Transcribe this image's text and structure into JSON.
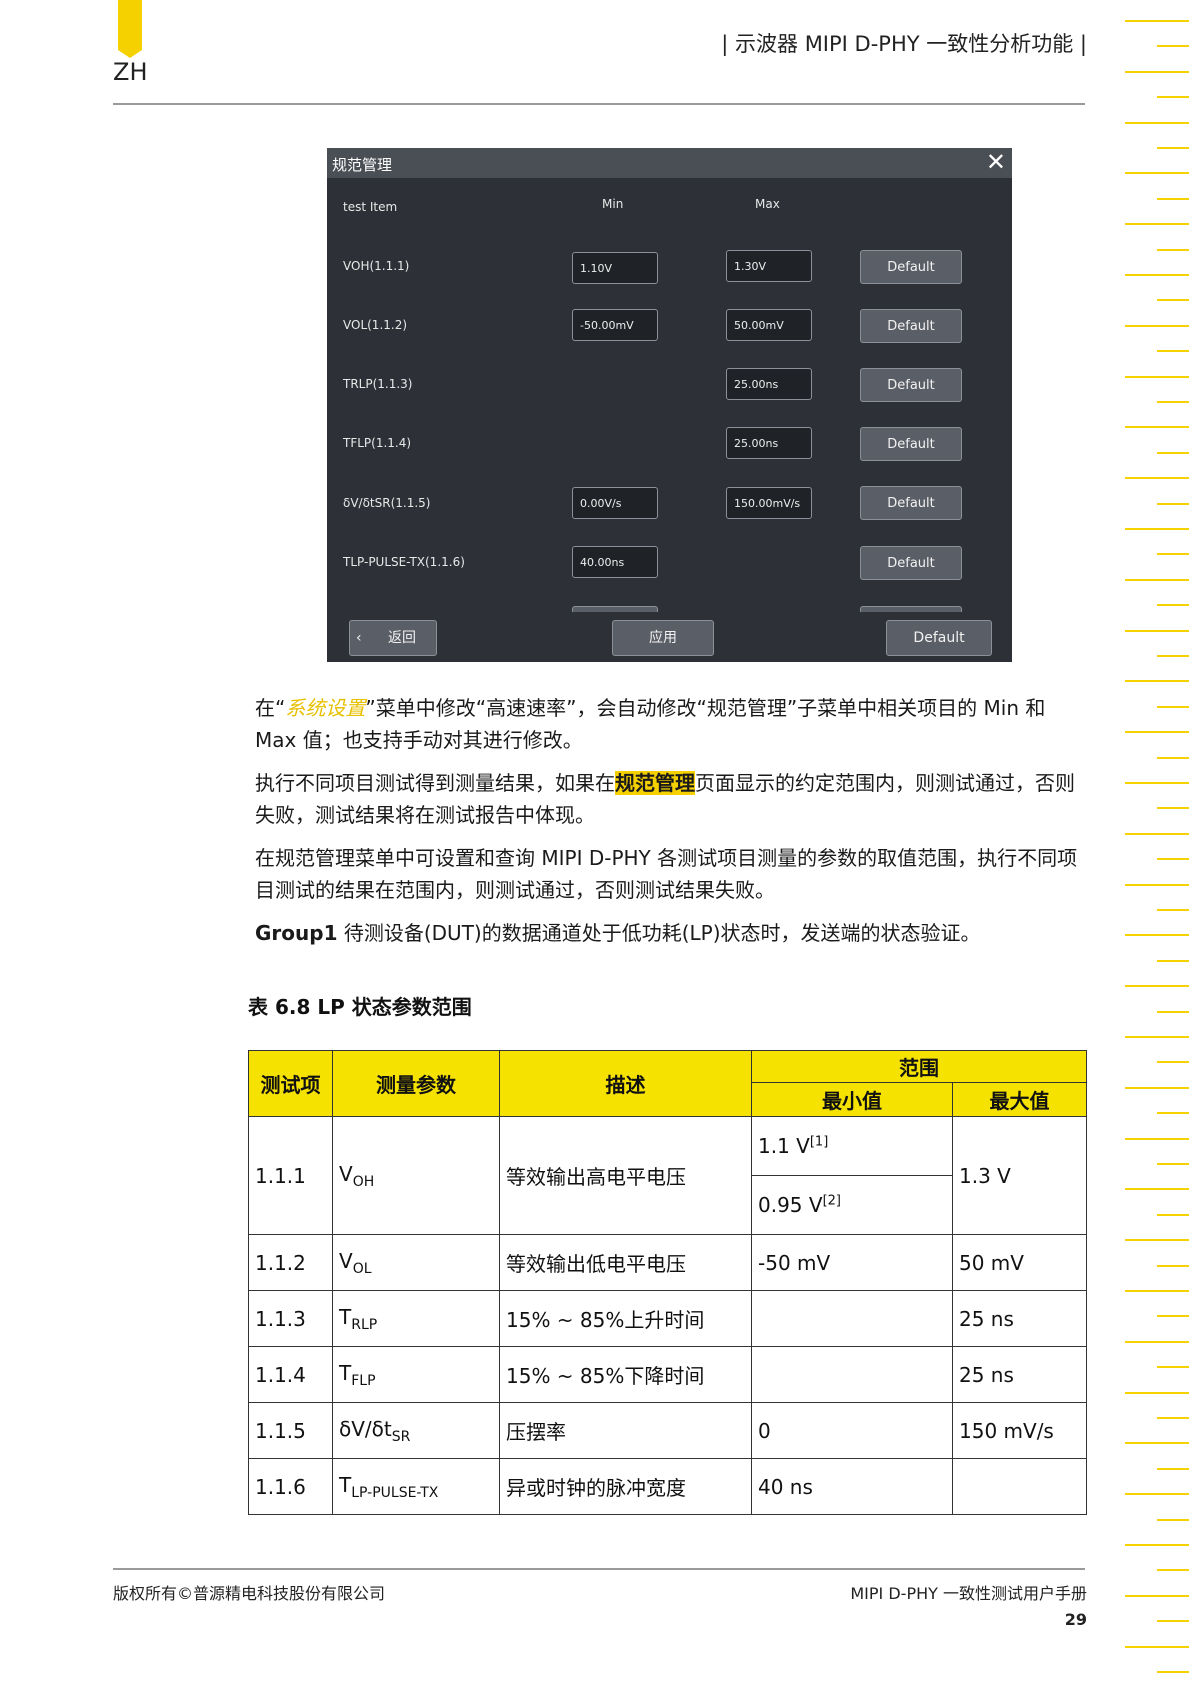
{
  "header": {
    "lang": "ZH",
    "title": "| 示波器 MIPI D-PHY 一致性分析功能 |"
  },
  "dialog": {
    "title": "规范管理",
    "col_test_item": "test Item",
    "col_min": "Min",
    "col_max": "Max",
    "rows": [
      {
        "label": "VOH(1.1.1)",
        "min": "1.10V",
        "max": "1.30V",
        "btn": "Default"
      },
      {
        "label": "VOL(1.1.2)",
        "min": "-50.00mV",
        "max": "50.00mV",
        "btn": "Default"
      },
      {
        "label": "TRLP(1.1.3)",
        "min": "",
        "max": "25.00ns",
        "btn": "Default"
      },
      {
        "label": "TFLP(1.1.4)",
        "min": "",
        "max": "25.00ns",
        "btn": "Default"
      },
      {
        "label": "δV/δtSR(1.1.5)",
        "min": "0.00V/s",
        "max": "150.00mV/s",
        "btn": "Default"
      },
      {
        "label": "TLP-PULSE-TX(1.1.6)",
        "min": "40.00ns",
        "max": "",
        "btn": "Default"
      }
    ],
    "back_label": "返回",
    "apply_label": "应用",
    "default_label": "Default"
  },
  "body": {
    "p1_a": "在“",
    "p1_link": "系统设置",
    "p1_b": "”菜单中修改“高速速率”，会自动修改“规范管理”子菜单中相关项目的 Min 和 Max 值；也支持手动对其进行修改。",
    "p2_a": "执行不同项目测试得到测量结果，如果在",
    "p2_mark": "规范管理",
    "p2_b": "页面显示的约定范围内，则测试通过，否则失败，测试结果将在测试报告中体现。",
    "p3": "在规范管理菜单中可设置和查询 MIPI D-PHY 各测试项目测量的参数的取值范围，执行不同项目测试的结果在范围内，则测试通过，否则测试结果失败。",
    "p4_bold": "Group1",
    "p4_rest": " 待测设备(DUT)的数据通道处于低功耗(LP)状态时，发送端的状态验证。"
  },
  "table": {
    "caption": "表 6.8 LP 状态参数范围",
    "headers": {
      "item": "测试项",
      "param": "测量参数",
      "desc": "描述",
      "range": "范围",
      "min": "最小值",
      "max": "最大值"
    },
    "rows": [
      {
        "item": "1.1.1",
        "param_main": "V",
        "param_sub": "OH",
        "desc": "等效输出高电平电压",
        "min_a": "1.1 V",
        "min_a_sup": "[1]",
        "min_b": "0.95 V",
        "min_b_sup": "[2]",
        "max": "1.3 V"
      },
      {
        "item": "1.1.2",
        "param_main": "V",
        "param_sub": "OL",
        "desc": "等效输出低电平电压",
        "min": "-50 mV",
        "max": "50 mV"
      },
      {
        "item": "1.1.3",
        "param_main": "T",
        "param_sub": "RLP",
        "desc": "15% ~ 85%上升时间",
        "min": "",
        "max": "25 ns"
      },
      {
        "item": "1.1.4",
        "param_main": "T",
        "param_sub": "FLP",
        "desc": "15% ~ 85%下降时间",
        "min": "",
        "max": "25 ns"
      },
      {
        "item": "1.1.5",
        "param_main": "δV/δt",
        "param_sub": "SR",
        "desc": "压摆率",
        "min": "0",
        "max": "150 mV/s"
      },
      {
        "item": "1.1.6",
        "param_main": "T",
        "param_sub": "LP-PULSE-TX",
        "desc": "异或时钟的脉冲宽度",
        "min": "40 ns",
        "max": ""
      }
    ]
  },
  "footer": {
    "copyright": "版权所有©普源精电科技股份有限公司",
    "manual": "MIPI D-PHY 一致性测试用户手册",
    "page": "29"
  }
}
